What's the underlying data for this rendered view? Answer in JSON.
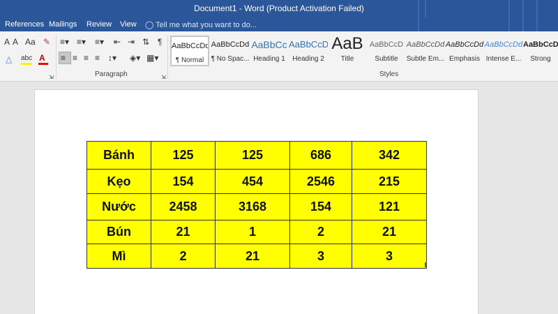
{
  "window": {
    "title": "Document1 - Word (Product Activation Failed)"
  },
  "menu": {
    "tabs": [
      "References",
      "Mailings",
      "Review",
      "View"
    ],
    "tell_me": "Tell me what you want to do..."
  },
  "ribbon": {
    "paragraph_label": "Paragraph",
    "styles_label": "Styles",
    "font_icons": [
      "A",
      "A",
      "Aa",
      "abc",
      "A"
    ],
    "styles": [
      {
        "sample": "AaBbCcDd",
        "name": "¶ Normal"
      },
      {
        "sample": "AaBbCcDd",
        "name": "¶ No Spac..."
      },
      {
        "sample": "AaBbCc",
        "name": "Heading 1"
      },
      {
        "sample": "AaBbCcD",
        "name": "Heading 2"
      },
      {
        "sample": "AaB",
        "name": "Title"
      },
      {
        "sample": "AaBbCcD",
        "name": "Subtitle"
      },
      {
        "sample": "AaBbCcDd",
        "name": "Subtle Em..."
      },
      {
        "sample": "AaBbCcDd",
        "name": "Emphasis"
      },
      {
        "sample": "AaBbCcDd",
        "name": "Intense E..."
      },
      {
        "sample": "AaBbCcDd",
        "name": "Strong"
      }
    ]
  },
  "table": {
    "rows": [
      [
        "Bánh",
        "125",
        "125",
        "686",
        "342"
      ],
      [
        "Kẹo",
        "154",
        "454",
        "2546",
        "215"
      ],
      [
        "Nước",
        "2458",
        "3168",
        "154",
        "121"
      ],
      [
        "Bún",
        "21",
        "1",
        "2",
        "21"
      ],
      [
        "Mì",
        "2",
        "21",
        "3",
        "3"
      ]
    ],
    "fill_color": "#ffff00"
  },
  "colors": {
    "accent": "#2b579a",
    "ribbon": "#f3f3f3",
    "workspace": "#e6e6e6"
  }
}
